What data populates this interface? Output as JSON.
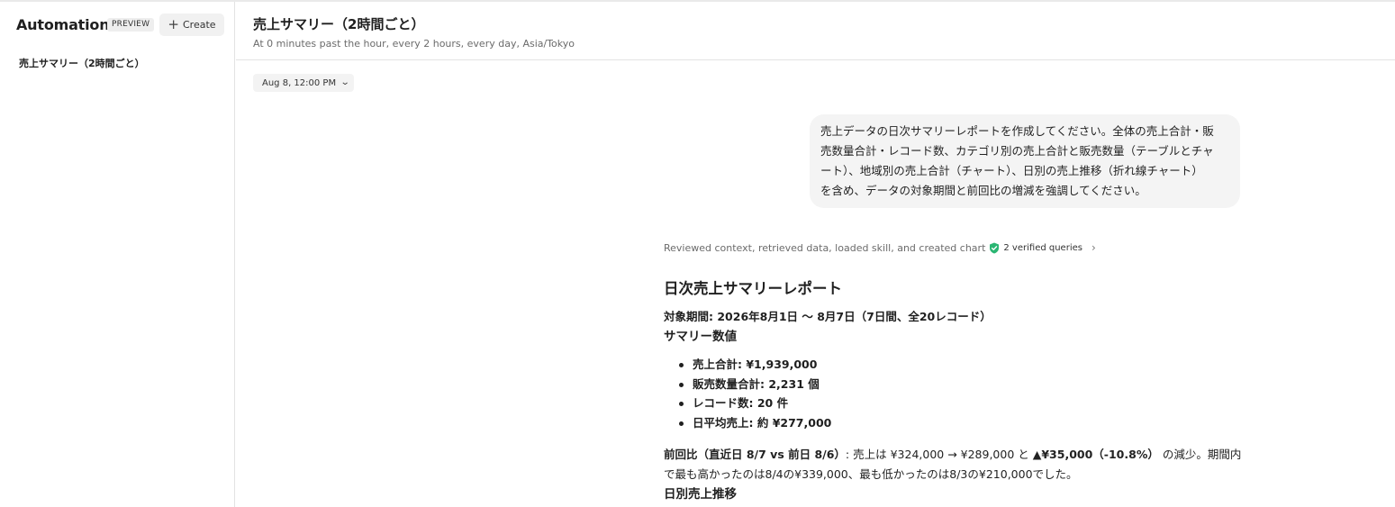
{
  "sidebar": {
    "title": "Automations",
    "badge": "PREVIEW",
    "create_label": "Create",
    "items": [
      {
        "label": "売上サマリー（2時間ごと）"
      }
    ]
  },
  "header": {
    "title": "売上サマリー（2時間ごと）",
    "subtitle": "At 0 minutes past the hour, every 2 hours, every day, Asia/Tokyo"
  },
  "run_selector": {
    "value": "Aug 8, 12:00 PM"
  },
  "user_message": {
    "lines": [
      "売上データの日次サマリーレポートを作成してください。全体の売上合計・販",
      "売数量合計・レコード数、カテゴリ別の売上合計と販売数量（テーブルとチャ",
      "ート）、地域別の売上合計（チャート）、日別の売上推移（折れ線チャート）",
      "を含め、データの対象期間と前回比の増減を強調してください。"
    ]
  },
  "status": {
    "text": "Reviewed context, retrieved data, loaded skill, and created chart",
    "verified": "2 verified queries",
    "shield_color": "#2bb673"
  },
  "report": {
    "title": "日次売上サマリーレポート",
    "period": "対象期間: 2026年8月1日 〜 8月7日（7日間、全20レコード）",
    "summary_heading": "サマリー数値",
    "summary_items": [
      "売上合計: ¥1,939,000",
      "販売数量合計: 2,231 個",
      "レコード数: 20 件",
      "日平均売上: 約 ¥277,000"
    ],
    "comparison": {
      "label": "前回比（直近日 8/7 vs 前日 8/6）",
      "text1": ": 売上は ¥324,000 → ¥289,000 と ",
      "change": "▲¥35,000（-10.8%）",
      "text2": " の減少。期間内で最も高かったのは8/4の¥339,000、最も低かったのは8/3の¥210,000でした。"
    },
    "daily_heading": "日別売上推移"
  }
}
